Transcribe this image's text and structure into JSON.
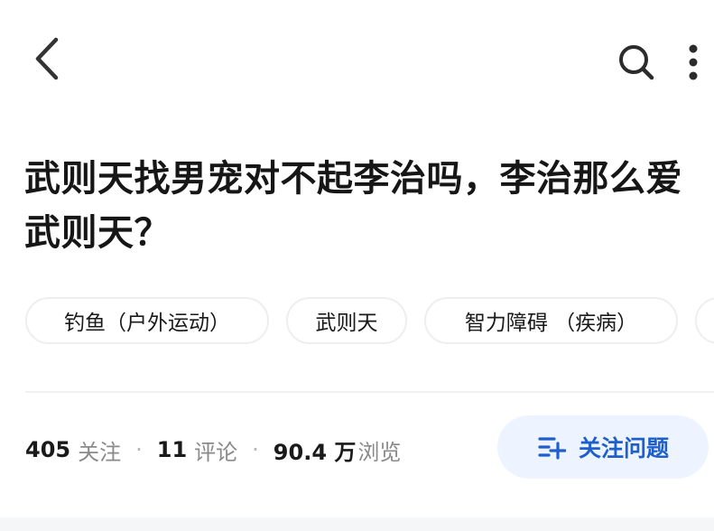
{
  "header": {
    "back_icon": "chevron-left-icon",
    "search_icon": "search-icon",
    "more_icon": "more-vertical-icon"
  },
  "question": {
    "title": "武则天找男宠对不起李治吗，李治那么爱武则天？"
  },
  "tags": [
    {
      "label": "钓鱼（户外运动）"
    },
    {
      "label": "武则天"
    },
    {
      "label": "智力障碍 （疾病）"
    },
    {
      "label": ""
    }
  ],
  "stats": {
    "followers_count": "405",
    "followers_label": "关注",
    "comments_count": "11",
    "comments_label": "评论",
    "views_count": "90.4 万",
    "views_label": "浏览",
    "separator": "·"
  },
  "follow_button": {
    "label": "关注问题",
    "icon": "add-list-icon",
    "accent_color": "#1f5fcc",
    "background_color": "#eef4ff"
  }
}
